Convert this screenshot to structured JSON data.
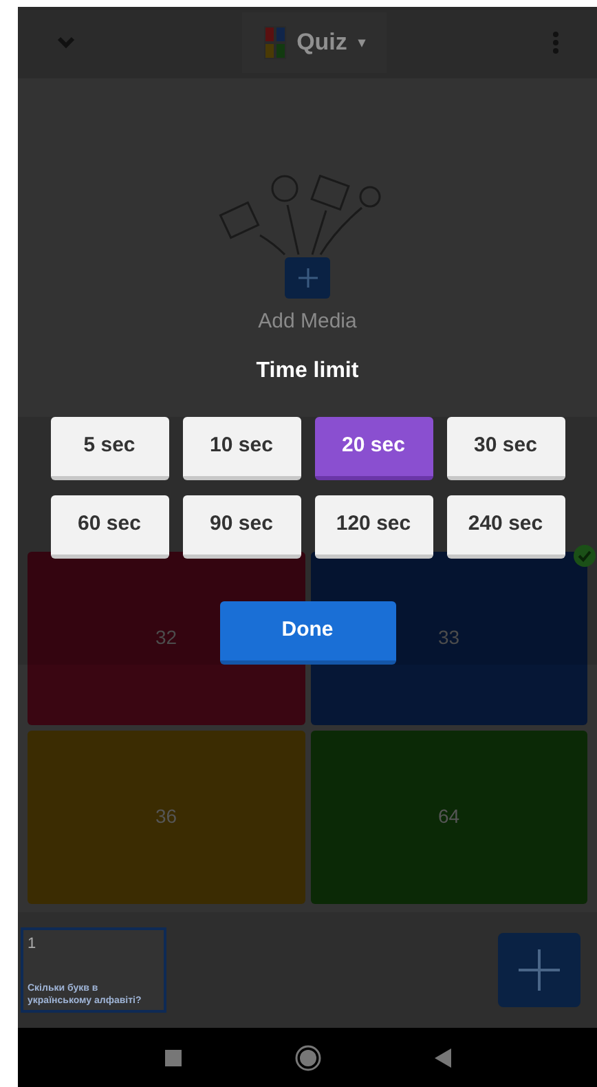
{
  "top_bar": {
    "title": "Quiz",
    "dropdown_caret": "▾"
  },
  "media": {
    "label": "Add Media"
  },
  "time_limit_dialog": {
    "title": "Time limit",
    "options": [
      {
        "label": "5 sec",
        "selected": false
      },
      {
        "label": "10 sec",
        "selected": false
      },
      {
        "label": "20 sec",
        "selected": true
      },
      {
        "label": "30 sec",
        "selected": false
      },
      {
        "label": "60 sec",
        "selected": false
      },
      {
        "label": "90 sec",
        "selected": false
      },
      {
        "label": "120 sec",
        "selected": false
      },
      {
        "label": "240 sec",
        "selected": false
      }
    ],
    "done_button": "Done"
  },
  "answers": [
    {
      "text": "32",
      "color": "#3a0612",
      "correct": false
    },
    {
      "text": "33",
      "color": "#061736",
      "correct": true
    },
    {
      "text": "36",
      "color": "#3b2c02",
      "correct": false
    },
    {
      "text": "64",
      "color": "#0b2906",
      "correct": false
    }
  ],
  "slides": [
    {
      "number": "1",
      "question": "Скільки букв в українському алфавіті?",
      "selected": true
    }
  ]
}
